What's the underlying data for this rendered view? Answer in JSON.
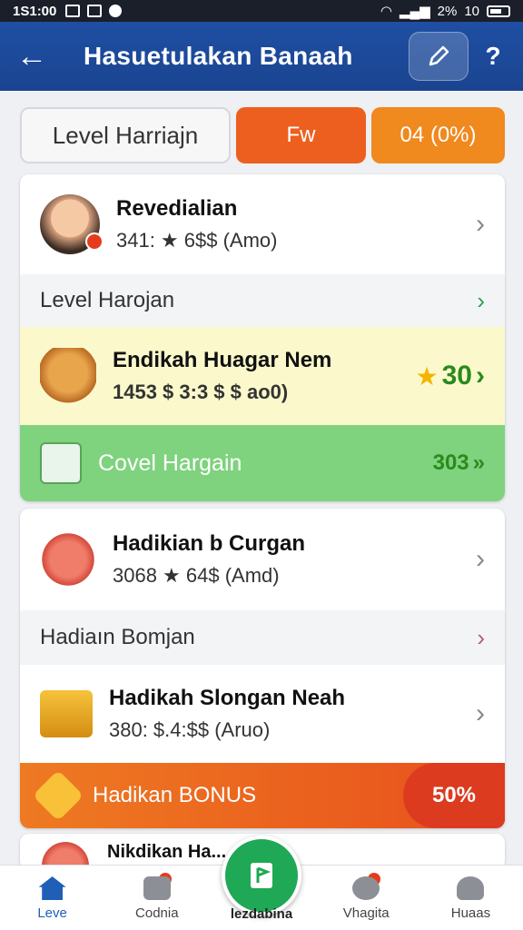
{
  "status_bar": {
    "time": "1S1:00",
    "battery": "2%",
    "signal_text": "10"
  },
  "app_bar": {
    "title": "Hasuetulakan Banaah",
    "help": "?"
  },
  "filters": {
    "level": "Level Harriajn",
    "fw": "Fw",
    "od": "04 (0%)"
  },
  "cards": {
    "first": {
      "name": "Revedialian",
      "sub": "341: ★ 6$$ (Amo)"
    },
    "section1": "Level Harojan",
    "item_yellow": {
      "name": "Endikah Huagar Nem",
      "sub": "1453 $ 3:3 $ $ ao0)",
      "score": "30"
    },
    "item_green": {
      "name": "Covel Hargain",
      "score": "303"
    },
    "second": {
      "name": "Hadikian b Curgan",
      "sub": "3068 ★ 64$ (Amd)"
    },
    "section2": "Hadiaın Bomjan",
    "third": {
      "name": "Hadikah Slongan Neah",
      "sub": "380: $.4:$$ (Aruo)"
    },
    "bonus": {
      "name": "Hadikan BONUS",
      "pct": "50%"
    },
    "partial": {
      "name": "Nikdikan Ha..."
    }
  },
  "bottom_nav": {
    "home": "Leve",
    "second": "Codnia",
    "center": "lezdabina",
    "fourth": "Vhagita",
    "fifth": "Huaas"
  },
  "colors": {
    "primary": "#1f4fa3",
    "accent_orange": "#ec5f1f",
    "green": "#7fd27e",
    "fab": "#1fa855"
  }
}
